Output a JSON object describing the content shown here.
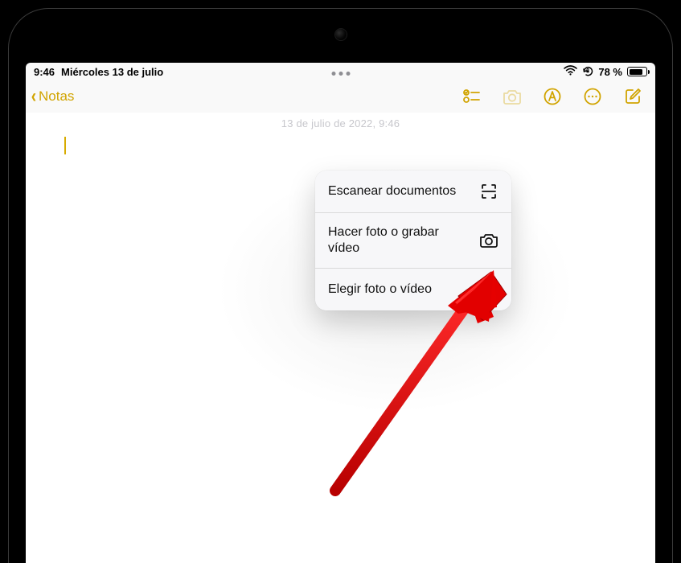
{
  "statusbar": {
    "time": "9:46",
    "date": "Miércoles 13 de julio",
    "battery_pct_label": "78 %",
    "battery_pct": 78
  },
  "toolbar": {
    "back_label": "Notas"
  },
  "note": {
    "meta": "13 de julio de 2022, 9:46"
  },
  "menu": {
    "items": [
      {
        "label": "Escanear documentos",
        "icon": "scan-icon"
      },
      {
        "label": "Hacer foto o grabar vídeo",
        "icon": "camera-icon"
      },
      {
        "label": "Elegir foto o vídeo",
        "icon": "gallery-icon"
      }
    ]
  }
}
